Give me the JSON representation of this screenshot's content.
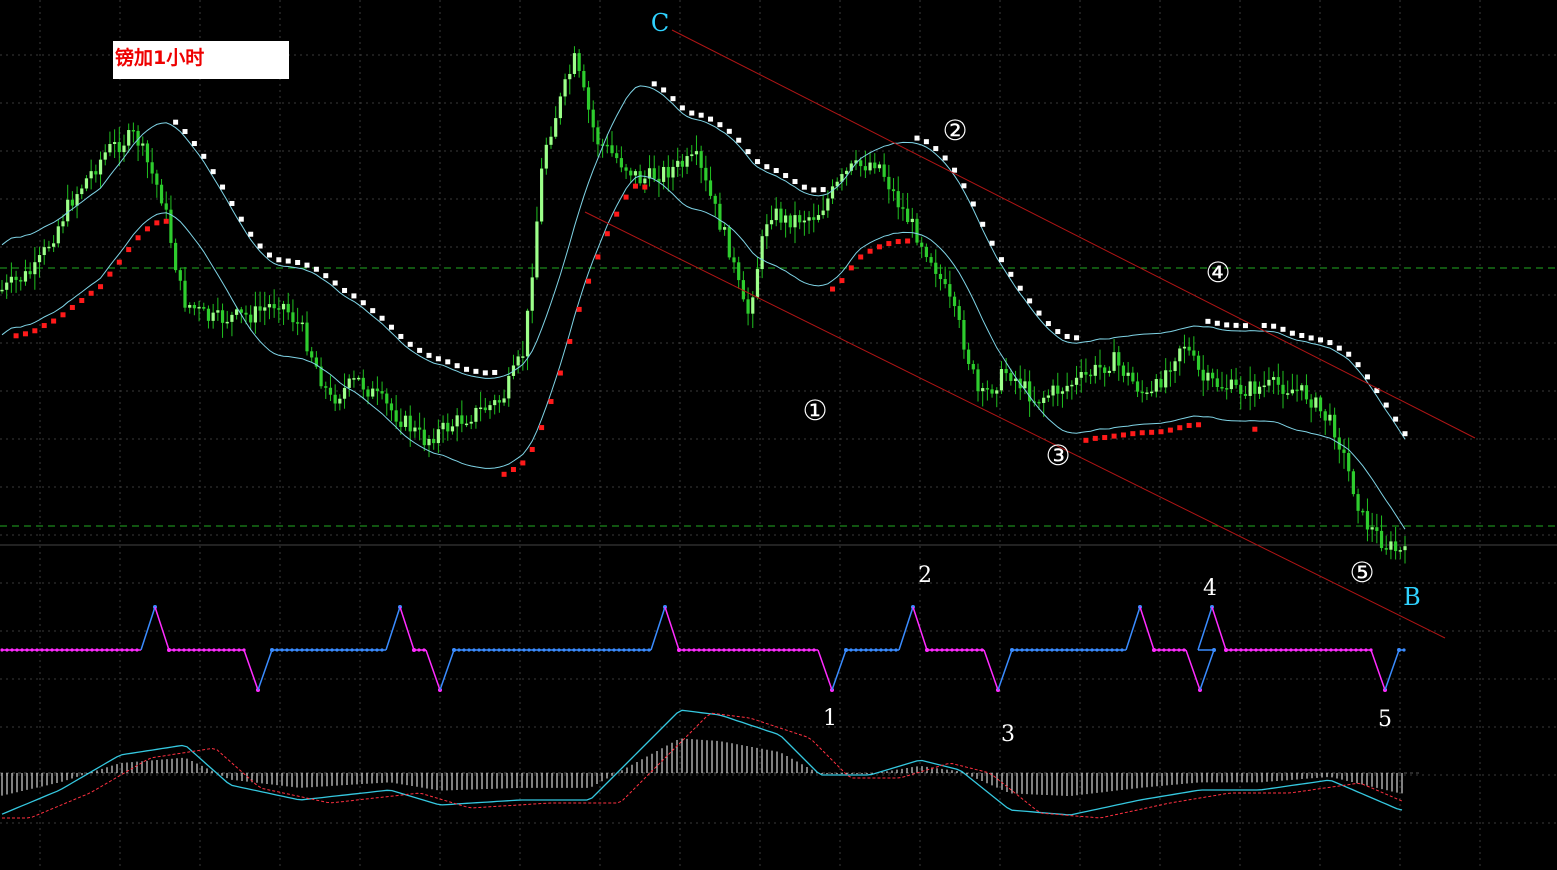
{
  "title": "镑加1小时",
  "labels": {
    "top_c": "C",
    "bottom_b": "B",
    "circled": [
      "①",
      "②",
      "③",
      "④",
      "⑤"
    ],
    "plain": [
      "1",
      "2",
      "3",
      "4",
      "5"
    ]
  },
  "colors": {
    "background": "#000000",
    "grid": "#3a3a3a",
    "bull_candle": "#9dff8a",
    "bear_candle": "#2ecc2e",
    "wick": "#20c020",
    "sar_up": "#ff1a1a",
    "sar_down": "#ffffff",
    "band": "#7fd4e6",
    "channel": "#b01515",
    "hline": "#22aa22",
    "label_cyan": "#2fd2ff",
    "label_white": "#ffffff",
    "zigzag_up": "#3a8cff",
    "zigzag_down": "#ff2cff",
    "macd_main": "#35c8e0",
    "macd_signal": "#ff3040",
    "macd_hist": "#ffffff"
  },
  "chart_data": [
    {
      "type": "candlestick",
      "title": "镑加1小时",
      "points": 300,
      "overlays": [
        "parabolic-sar",
        "bands",
        "descending-channel",
        "horizontal-levels"
      ],
      "swing_values": [
        0.0,
        -1.2,
        -0.2,
        -2.8,
        5.2,
        2.6,
        -1.8,
        0.6,
        -2.6,
        -4.0,
        -6.6
      ],
      "wave_labels": [
        "C",
        "①",
        "②",
        "③",
        "④",
        "⑤",
        "B"
      ],
      "grid": true
    },
    {
      "type": "line",
      "name": "zigzag-oscillator",
      "levels": [
        1,
        0,
        -1
      ],
      "wave_labels": [
        "1",
        "2",
        "3",
        "4",
        "5"
      ]
    },
    {
      "type": "area",
      "name": "macd",
      "components": [
        "histogram",
        "main",
        "signal"
      ]
    }
  ]
}
